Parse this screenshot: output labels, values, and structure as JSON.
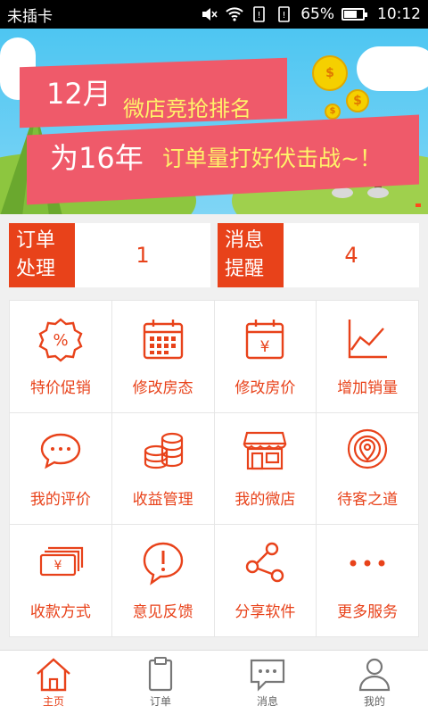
{
  "status_bar": {
    "carrier": "未插卡",
    "battery_text": "65%",
    "battery_level": 0.65,
    "time": "10:12"
  },
  "banner": {
    "month": "12月",
    "headline": "微店竞抢排名",
    "line2_prefix": "为16年",
    "line2_suffix": "订单量打好伏击战~！"
  },
  "summary": [
    {
      "label_line1": "订单",
      "label_line2": "处理",
      "value": "1"
    },
    {
      "label_line1": "消息",
      "label_line2": "提醒",
      "value": "4"
    }
  ],
  "grid": [
    {
      "label": "特价促销",
      "icon": "discount-badge-icon"
    },
    {
      "label": "修改房态",
      "icon": "calendar-icon"
    },
    {
      "label": "修改房价",
      "icon": "price-calendar-icon"
    },
    {
      "label": "增加销量",
      "icon": "line-chart-icon"
    },
    {
      "label": "我的评价",
      "icon": "chat-bubble-icon"
    },
    {
      "label": "收益管理",
      "icon": "coins-icon"
    },
    {
      "label": "我的微店",
      "icon": "storefront-icon"
    },
    {
      "label": "待客之道",
      "icon": "location-pin-icon"
    },
    {
      "label": "收款方式",
      "icon": "cash-icon"
    },
    {
      "label": "意见反馈",
      "icon": "exclamation-bubble-icon"
    },
    {
      "label": "分享软件",
      "icon": "share-icon"
    },
    {
      "label": "更多服务",
      "icon": "more-dots-icon"
    }
  ],
  "tabbar": [
    {
      "label": "主页",
      "icon": "home-icon",
      "active": true
    },
    {
      "label": "订单",
      "icon": "clipboard-icon",
      "active": false
    },
    {
      "label": "消息",
      "icon": "message-icon",
      "active": false
    },
    {
      "label": "我的",
      "icon": "user-icon",
      "active": false
    }
  ],
  "colors": {
    "accent": "#e8421a",
    "banner_sky": "#4ec6f2",
    "ribbon": "#ef5a6a",
    "highlight_text": "#fff36a"
  }
}
